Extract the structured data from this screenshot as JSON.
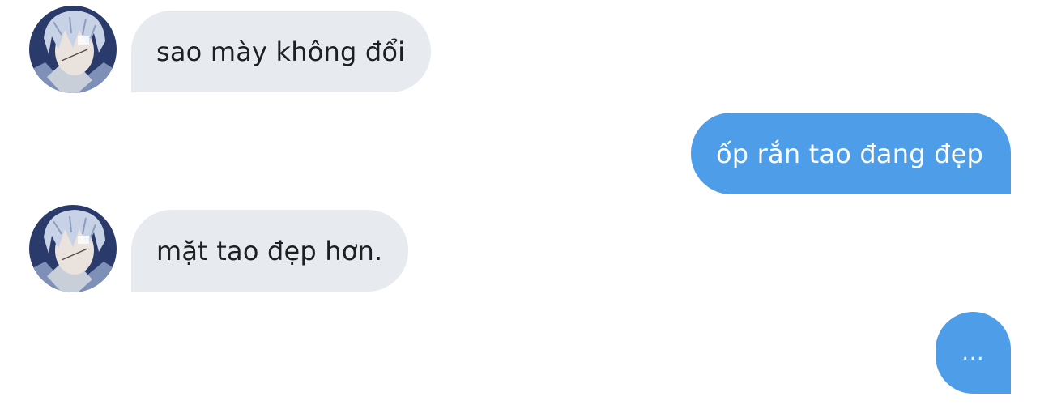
{
  "messages": [
    {
      "sender": "contact",
      "text": "sao mày không đổi"
    },
    {
      "sender": "me",
      "text": "ốp rắn tao đang đẹp"
    },
    {
      "sender": "contact",
      "text": "mặt tao đẹp hơn."
    },
    {
      "sender": "me",
      "text": "..."
    }
  ],
  "colors": {
    "incoming_bubble": "#e7eaee",
    "outgoing_bubble": "#4d9de8",
    "background": "#ffffff"
  },
  "icons": {
    "contact_avatar": "anime-boy-avatar"
  }
}
